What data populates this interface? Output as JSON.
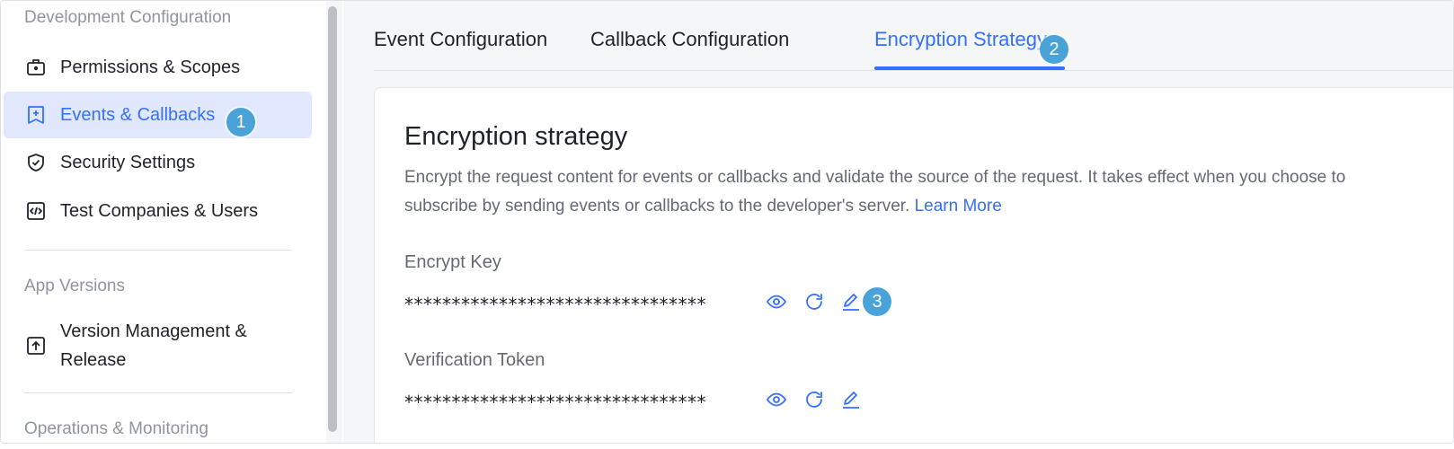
{
  "sidebar": {
    "section_dev": "Development Configuration",
    "items": [
      {
        "label": "Permissions & Scopes",
        "icon": "briefcase-icon"
      },
      {
        "label": "Events & Callbacks",
        "icon": "plus-square-icon",
        "active": true
      },
      {
        "label": "Security Settings",
        "icon": "shield-check-icon"
      },
      {
        "label": "Test Companies & Users",
        "icon": "code-square-icon"
      }
    ],
    "section_versions": "App Versions",
    "version_item": {
      "label": "Version Management & Release",
      "icon": "upload-square-icon"
    },
    "section_ops": "Operations & Monitoring"
  },
  "tabs": [
    {
      "label": "Event Configuration"
    },
    {
      "label": "Callback Configuration"
    },
    {
      "label": "Encryption Strategy",
      "active": true
    }
  ],
  "card": {
    "title": "Encryption strategy",
    "description": "Encrypt the request content for events or callbacks and validate the source of the request. It takes effect when you choose to subscribe by sending events or callbacks to the developer's server.",
    "learn_more": "Learn More",
    "encrypt_key_label": "Encrypt Key",
    "encrypt_key_value": "********************************",
    "verification_token_label": "Verification Token",
    "verification_token_value": "********************************"
  },
  "badges": {
    "one": "1",
    "two": "2",
    "three": "3"
  },
  "colors": {
    "accent": "#3370ff",
    "active_bg": "#e1e8fd",
    "badge": "#4aa3d8"
  }
}
